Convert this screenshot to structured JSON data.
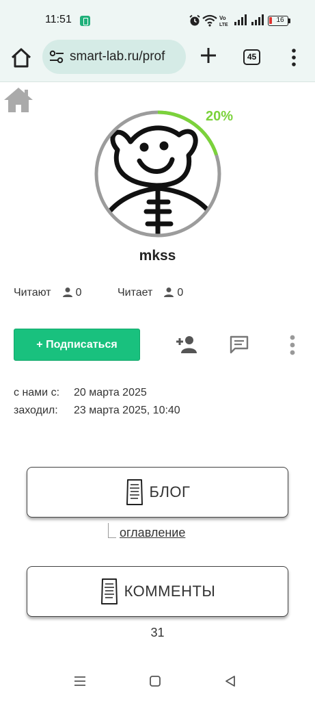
{
  "status_bar": {
    "time": "11:51",
    "battery_level": "16",
    "icons": [
      "app-notification-icon",
      "alarm-icon",
      "wifi-icon",
      "volte-icon",
      "signal-icon",
      "signal-icon",
      "battery-icon"
    ],
    "battery_color": "#e0342f"
  },
  "browser": {
    "url": "smart-lab.ru/prof",
    "tab_count": "45",
    "icons": [
      "home-icon",
      "site-settings-icon",
      "new-tab-icon",
      "tabs-icon",
      "menu-icon"
    ]
  },
  "profile": {
    "progress_percent": 20,
    "progress_label": "20%",
    "progress_color": "#7bd23b",
    "username": "mkss",
    "followers_label": "Читают",
    "followers_count": "0",
    "following_label": "Читает",
    "following_count": "0",
    "subscribe_label": "+ Подписаться",
    "subscribe_color": "#19c17e",
    "actions": [
      "add-friend-icon",
      "message-icon",
      "more-icon"
    ],
    "joined_label": "с нами с:",
    "joined_value": "20 марта 2025",
    "last_seen_label": "заходил:",
    "last_seen_value": "23 марта 2025, 10:40"
  },
  "sections": {
    "blog_label": "БЛОГ",
    "toc_label": "оглавление",
    "comments_label": "КОММЕНТЫ",
    "comments_count": "31"
  },
  "nav_bar": {
    "icons": [
      "recents-icon",
      "home-icon",
      "back-icon"
    ]
  }
}
